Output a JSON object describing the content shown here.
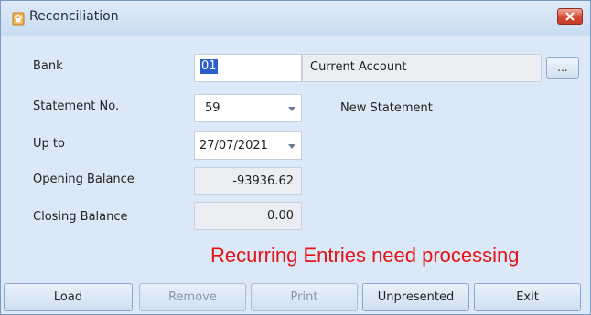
{
  "window": {
    "title": "Reconciliation",
    "icon": "home-icon"
  },
  "form": {
    "bank": {
      "label": "Bank",
      "code": "01",
      "account_name": "Current Account",
      "browse_label": "..."
    },
    "statement_no": {
      "label": "Statement No.",
      "value": "59",
      "status": "New Statement"
    },
    "up_to": {
      "label": "Up to",
      "value": "27/07/2021"
    },
    "opening_balance": {
      "label": "Opening Balance",
      "value": "-93936.62"
    },
    "closing_balance": {
      "label": "Closing Balance",
      "value": "0.00"
    }
  },
  "warning": {
    "text": "Recurring Entries need processing",
    "color": "#e51313"
  },
  "buttons": {
    "load": "Load",
    "remove": "Remove",
    "print": "Print",
    "unpresented": "Unpresented",
    "exit": "Exit"
  },
  "colors": {
    "window_bg": "#dbe8f7",
    "selection": "#2c5fc9",
    "close_button": "#d44c38"
  }
}
